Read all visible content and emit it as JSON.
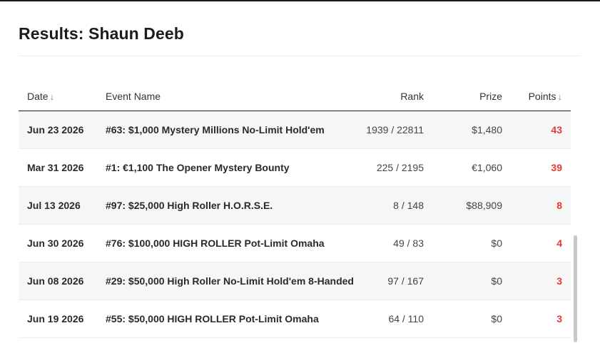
{
  "page": {
    "title": "Results: Shaun Deeb"
  },
  "table": {
    "columns": {
      "date": "Date",
      "event": "Event Name",
      "rank": "Rank",
      "prize": "Prize",
      "points": "Points"
    },
    "sort_arrow": "↓",
    "rows": [
      {
        "date": "Jun 23 2026",
        "event": "#63: $1,000 Mystery Millions No-Limit Hold'em",
        "rank": "1939 / 22811",
        "prize": "$1,480",
        "points": "43"
      },
      {
        "date": "Mar 31 2026",
        "event": "#1: €1,100 The Opener Mystery Bounty",
        "rank": "225 / 2195",
        "prize": "€1,060",
        "points": "39"
      },
      {
        "date": "Jul 13 2026",
        "event": "#97: $25,000 High Roller H.O.R.S.E.",
        "rank": "8 / 148",
        "prize": "$88,909",
        "points": "8"
      },
      {
        "date": "Jun 30 2026",
        "event": "#76: $100,000 HIGH ROLLER Pot-Limit Omaha",
        "rank": "49 / 83",
        "prize": "$0",
        "points": "4"
      },
      {
        "date": "Jun 08 2026",
        "event": "#29: $50,000 High Roller No-Limit Hold'em 8-Handed",
        "rank": "97 / 167",
        "prize": "$0",
        "points": "3"
      },
      {
        "date": "Jun 19 2026",
        "event": "#55: $50,000 HIGH ROLLER Pot-Limit Omaha",
        "rank": "64 / 110",
        "prize": "$0",
        "points": "3"
      }
    ]
  },
  "colors": {
    "points": "#e53935",
    "row_shade": "#f6f6f6"
  }
}
